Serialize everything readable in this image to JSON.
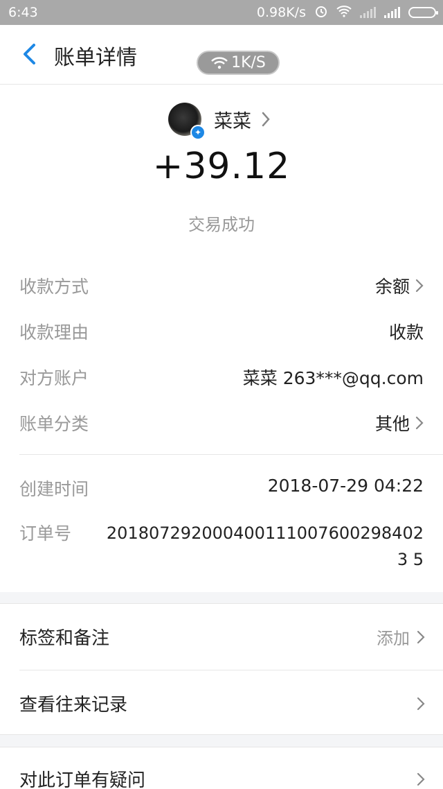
{
  "statusbar": {
    "time": "6:43",
    "net_speed": "0.98K/s"
  },
  "header": {
    "title": "账单详情",
    "speed_pill": "1K/S"
  },
  "payee": {
    "name": "菜菜"
  },
  "transaction": {
    "amount": "+39.12",
    "status": "交易成功"
  },
  "details": [
    {
      "label": "收款方式",
      "value": "余额"
    },
    {
      "label": "收款理由",
      "value": "收款"
    },
    {
      "label": "对方账户",
      "value": "菜菜 263***@qq.com"
    },
    {
      "label": "账单分类",
      "value": "其他"
    }
  ],
  "meta": {
    "created_label": "创建时间",
    "created_value": "2018-07-29 04:22",
    "order_label": "订单号",
    "order_value": "2018072920004001110076002984023 5"
  },
  "actions": {
    "tags_label": "标签和备注",
    "tags_action": "添加",
    "history_label": "查看往来记录",
    "question_label": "对此订单有疑问"
  },
  "colors": {
    "accent": "#1e88e5",
    "muted": "#999999",
    "statusbar_bg": "#a9a9a9"
  }
}
